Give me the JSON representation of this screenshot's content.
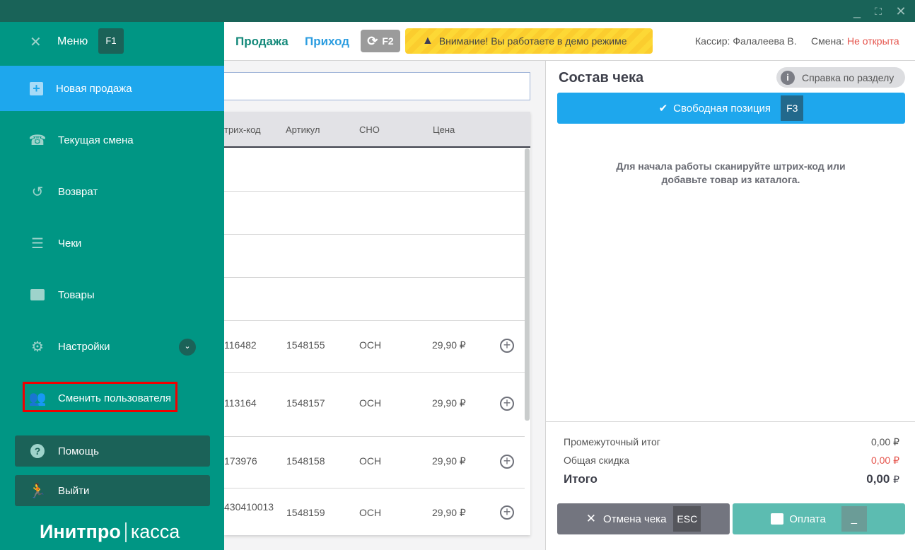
{
  "window": {
    "minimize": "_",
    "maximize": "⛶",
    "close": "✕"
  },
  "sidebar": {
    "menu_label": "Меню",
    "menu_key": "F1",
    "items": [
      {
        "label": "Новая продажа",
        "icon": "plus-square-icon"
      },
      {
        "label": "Текущая смена",
        "icon": "user-shift-icon"
      },
      {
        "label": "Возврат",
        "icon": "undo-icon"
      },
      {
        "label": "Чеки",
        "icon": "receipt-icon"
      },
      {
        "label": "Товары",
        "icon": "folder-icon"
      },
      {
        "label": "Настройки",
        "icon": "gear-icon"
      },
      {
        "label": "Сменить пользователя",
        "icon": "users-icon"
      }
    ],
    "help": "Помощь",
    "logout": "Выйти",
    "logo_left": "Инитпро",
    "logo_right": "касса"
  },
  "header": {
    "tab_sale": "Продажа",
    "tab_income": "Приход",
    "sync_key": "F2",
    "demo_warning": "Внимание! Вы работаете в демо режиме",
    "cashier": "Кассир: Фалалеева В.",
    "shift_label": "Смена:",
    "shift_status": "Не открыта"
  },
  "colors": {
    "sidebar": "#009684",
    "active": "#1ea7ed",
    "titlebar": "#196358",
    "shift_status": "#e5534b"
  },
  "table": {
    "columns": [
      "трих-код",
      "Артикул",
      "СНО",
      "Цена"
    ],
    "rows": [
      {
        "barcode": "116482",
        "article": "1548155",
        "tax": "ОСН",
        "price": "29,90 ₽"
      },
      {
        "barcode": "113164",
        "article": "1548157",
        "tax": "ОСН",
        "price": "29,90 ₽"
      },
      {
        "barcode": "173976",
        "article": "1548158",
        "tax": "ОСН",
        "price": "29,90 ₽"
      },
      {
        "barcode": "430410013",
        "article": "1548159",
        "tax": "ОСН",
        "price": "29,90 ₽"
      }
    ]
  },
  "receipt": {
    "title": "Состав чека",
    "help": "Справка по разделу",
    "free_position": "Свободная позиция",
    "free_key": "F3",
    "empty_line1": "Для начала работы сканируйте штрих-код или",
    "empty_line2": "добавьте товар из каталога.",
    "subtotal_label": "Промежуточный итог",
    "subtotal": "0,00 ₽",
    "discount_label": "Общая скидка",
    "discount": "0,00 ₽",
    "total_label": "Итого",
    "total": "0,00",
    "currency": "₽",
    "cancel": "Отмена чека",
    "cancel_key": "ESC",
    "pay": "Оплата",
    "pay_key": "_"
  }
}
